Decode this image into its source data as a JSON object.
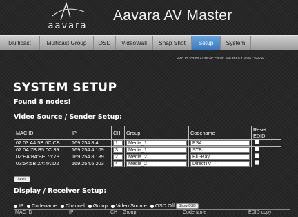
{
  "app": {
    "logo_text": "aavara",
    "title": "Aavara AV Master"
  },
  "nav": {
    "tabs": [
      {
        "label": "Multicast",
        "active": false
      },
      {
        "label": "Multicast Group",
        "active": false
      },
      {
        "label": "OSD",
        "active": false
      },
      {
        "label": "VideoWall",
        "active": false
      },
      {
        "label": "Snap Shot",
        "active": false
      },
      {
        "label": "Setup",
        "active": true
      },
      {
        "label": "System",
        "active": false
      }
    ]
  },
  "meta_line": "MAC ID : 02:03:A4:5B:6C:CB IP : 169.254.8.4 Node : Sender",
  "page": {
    "title": "SYSTEM SETUP",
    "found": "Found 8 nodes!"
  },
  "sender": {
    "title": "Video Source / Sender Setup:",
    "columns": [
      "MAC ID",
      "IP",
      "CH",
      "Group",
      "Codename",
      "Reset EDID"
    ],
    "rows": [
      {
        "mac": "02:03:A4:5B:6C:CB",
        "ip": "169.254.8.4",
        "ch": "1",
        "group": "Media_1",
        "codename": "PS4"
      },
      {
        "mac": "02:0A:7B:B5:0C:39",
        "ip": "169.254.4.109",
        "ch": "3",
        "group": "Media_1",
        "codename": "STB"
      },
      {
        "mac": "02:EA:B4:BE:76:78",
        "ip": "169.254.8.189",
        "ch": "2",
        "group": "Media_2",
        "codename": "Blu-Ray"
      },
      {
        "mac": "02:54:5B:2A:4A:D2",
        "ip": "169.254.6.203",
        "ch": "4",
        "group": "Media_2",
        "codename": "DirectTV"
      }
    ],
    "apply_label": "Apply"
  },
  "receiver": {
    "title": "Display / Receiver Setup:",
    "options": [
      "IP",
      "Codename",
      "Channel",
      "Group",
      "Video Source",
      "OSD Off"
    ],
    "show_osd_label": "Show OSD",
    "columns": [
      "MAC ID",
      "IP",
      "CH",
      "Group",
      "Codename",
      "EDID copy"
    ]
  },
  "colors": {
    "background": "#262626",
    "nav_bg": "#b8b8b8",
    "active_tab": "#4a8ad0"
  }
}
